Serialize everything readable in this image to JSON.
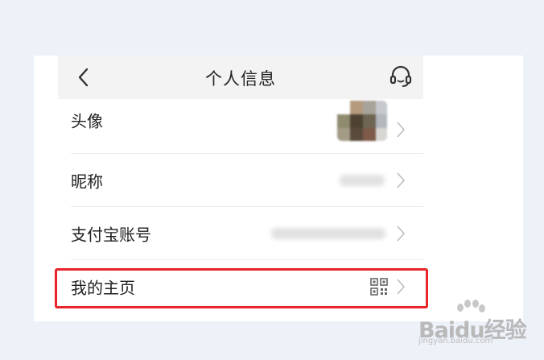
{
  "header": {
    "title": "个人信息",
    "back_icon": "chevron-left-icon",
    "support_icon": "headset-icon"
  },
  "rows": [
    {
      "label": "头像",
      "value_type": "avatar",
      "icon": "chevron-right-icon"
    },
    {
      "label": "昵称",
      "value_type": "blurred",
      "icon": "chevron-right-icon"
    },
    {
      "label": "支付宝账号",
      "value_type": "blurred",
      "icon": "chevron-right-icon"
    },
    {
      "label": "我的主页",
      "value_type": "qr-code",
      "icon": "chevron-right-icon"
    }
  ],
  "highlight_color": "#e8252b",
  "watermark": {
    "brand": "Baidu经验",
    "url": "jingyan.baidu.com"
  }
}
